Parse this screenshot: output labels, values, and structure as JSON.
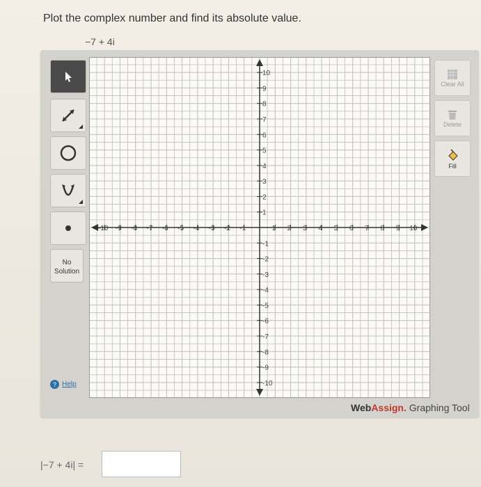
{
  "question": {
    "prompt": "Plot the complex number and find its absolute value.",
    "expression": "−7 + 4i"
  },
  "tools": {
    "pointer": "pointer-arrow-icon",
    "line": "line-segment-icon",
    "circle": "circle-icon",
    "parabola": "parabola-icon",
    "point": "point-icon",
    "no_solution": "No Solution",
    "help": "Help"
  },
  "actions": {
    "clear_all": "Clear All",
    "delete": "Delete",
    "fill": "Fill"
  },
  "graph": {
    "x_range": [
      -10,
      10
    ],
    "y_range": [
      -10,
      10
    ],
    "x_ticks": [
      "-10",
      "-9",
      "-8",
      "-7",
      "-6",
      "-5",
      "-4",
      "-3",
      "-2",
      "-1",
      "1",
      "2",
      "3",
      "4",
      "5",
      "6",
      "7",
      "8",
      "9",
      "10"
    ],
    "y_ticks": [
      "10",
      "9",
      "8",
      "7",
      "6",
      "5",
      "4",
      "3",
      "2",
      "1",
      "-1",
      "-2",
      "-3",
      "-4",
      "-5",
      "-6",
      "-7",
      "-8",
      "-9",
      "-10"
    ],
    "grid": true
  },
  "brand": {
    "web": "Web",
    "assign": "Assign.",
    "rest": " Graphing Tool"
  },
  "answer": {
    "label": "|−7 + 4i| =",
    "value": ""
  },
  "colors": {
    "accent_red": "#c0392b",
    "link_blue": "#2c6fa8",
    "panel": "#d4d2cc"
  }
}
